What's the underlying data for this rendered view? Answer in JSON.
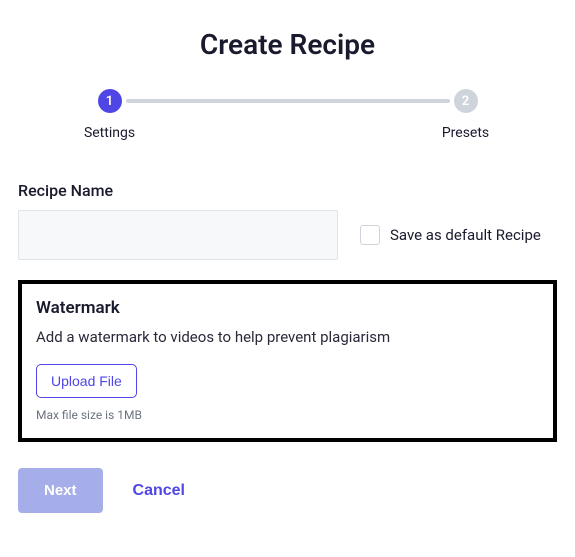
{
  "title": "Create Recipe",
  "stepper": {
    "steps": [
      {
        "num": "1",
        "label": "Settings",
        "active": true
      },
      {
        "num": "2",
        "label": "Presets",
        "active": false
      }
    ]
  },
  "recipeName": {
    "label": "Recipe Name",
    "value": ""
  },
  "saveDefault": {
    "label": "Save as default Recipe",
    "checked": false
  },
  "watermark": {
    "title": "Watermark",
    "description": "Add a watermark to videos to help prevent plagiarism",
    "uploadLabel": "Upload File",
    "hint": "Max file size is 1MB"
  },
  "actions": {
    "next": "Next",
    "cancel": "Cancel"
  }
}
